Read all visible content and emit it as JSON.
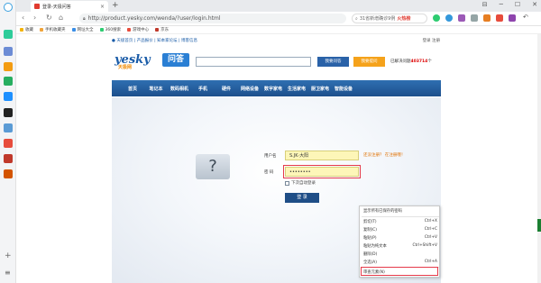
{
  "browser": {
    "tab_title": "登录-天极问答",
    "new_tab": "+",
    "window_buttons": [
      "⊟",
      "─",
      "☐",
      "✕"
    ],
    "url": "http://product.yesky.com/wenda/?user/login.html",
    "url_icon": "lock-icon",
    "search_hot": "火热榜",
    "search_text": "31省新增确诊9例",
    "bookmarks_label": "收藏",
    "bookmarks": [
      "手机收藏夹",
      "网址大全",
      "360搜索",
      "游戏中心",
      "京东"
    ]
  },
  "site": {
    "topbar_left": "● 天极首页 | 产品报价 | 知本家论坛 | 博客信息",
    "topbar_right": "登录  注册",
    "logo_text": "yesky",
    "logo_sub": "天极网",
    "logo_badge": "问答",
    "ask_button": "我要问答",
    "question_button": "我要提问",
    "solved_prefix": "已解决问题",
    "solved_count": "403714",
    "solved_suffix": "个",
    "nav": [
      "首页",
      "笔记本",
      "数码相机",
      "手机",
      "硬件",
      "网络设备",
      "数字家电",
      "生活家电",
      "厨卫家电",
      "智能设备"
    ]
  },
  "login": {
    "username_label": "用户名",
    "username_value": "S.JK·大阳",
    "password_label": "密  码",
    "password_value": "••••••••",
    "hint": "还没注册？ 在注册哦！",
    "remember_label": "下次自动登录",
    "login_button": "登 录"
  },
  "context_menu": {
    "items": [
      {
        "label": "显示所有已保存的密码",
        "shortcut": ""
      },
      {
        "label": "剪切(T)",
        "shortcut": "Ctrl+X"
      },
      {
        "label": "复制(C)",
        "shortcut": "Ctrl+C"
      },
      {
        "label": "粘贴(P)",
        "shortcut": "Ctrl+V"
      },
      {
        "label": "粘贴为纯文本",
        "shortcut": "Ctrl+Shift+V"
      },
      {
        "label": "删除(D)",
        "shortcut": ""
      },
      {
        "label": "全选(A)",
        "shortcut": "Ctrl+A"
      },
      {
        "label": "审查元素(N)",
        "shortcut": ""
      }
    ]
  },
  "sidebar": {
    "bottom": [
      "+",
      "≡"
    ]
  }
}
